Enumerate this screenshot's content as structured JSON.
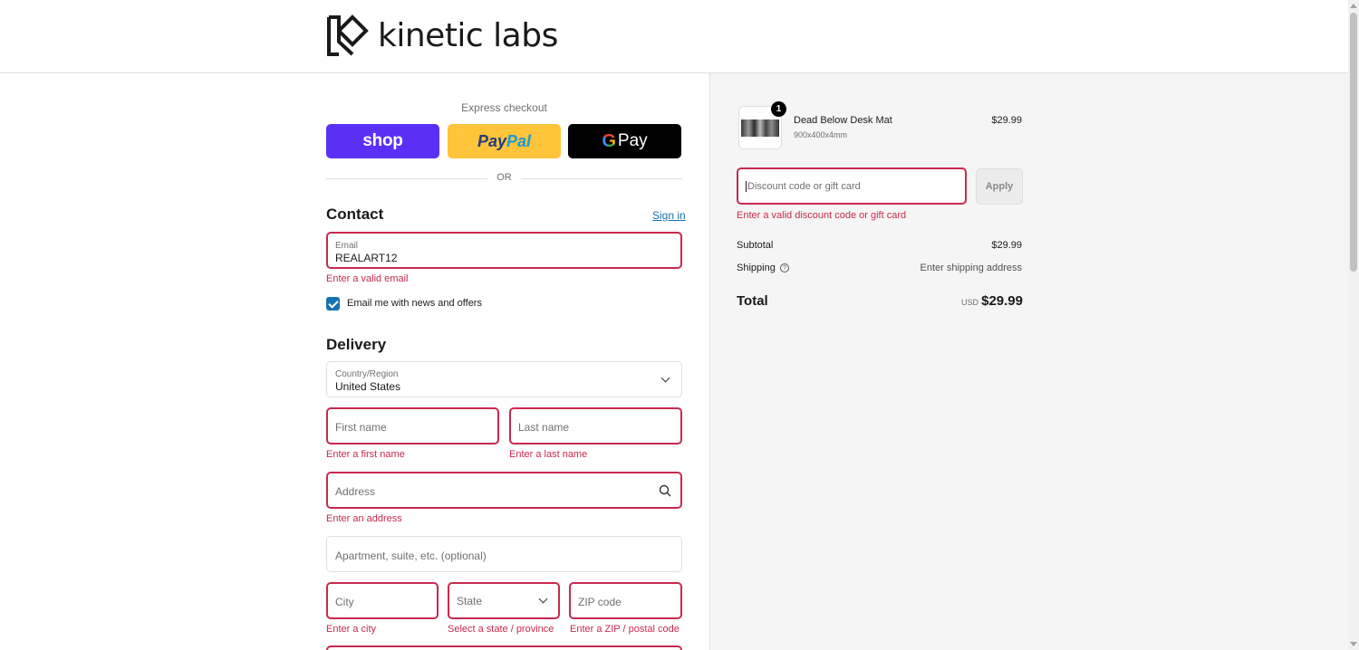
{
  "brand": {
    "name": "kinetic labs"
  },
  "express": {
    "title": "Express checkout",
    "shop_label": "shop",
    "paypal_label_1": "Pay",
    "paypal_label_2": "Pal",
    "gpay_g": "G",
    "gpay_label": "Pay",
    "or_label": "OR"
  },
  "contact": {
    "title": "Contact",
    "signin_label": "Sign in",
    "email_label": "Email",
    "email_value": "REALART12",
    "email_error": "Enter a valid email",
    "newsletter_label": "Email me with news and offers",
    "newsletter_checked": true
  },
  "delivery": {
    "title": "Delivery",
    "country_label": "Country/Region",
    "country_value": "United States",
    "first_name_placeholder": "First name",
    "first_name_error": "Enter a first name",
    "last_name_placeholder": "Last name",
    "last_name_error": "Enter a last name",
    "address_placeholder": "Address",
    "address_error": "Enter an address",
    "apartment_placeholder": "Apartment, suite, etc. (optional)",
    "city_placeholder": "City",
    "city_error": "Enter a city",
    "state_placeholder": "State",
    "state_error": "Select a state / province",
    "zip_placeholder": "ZIP code",
    "zip_error": "Enter a ZIP / postal code"
  },
  "summary": {
    "item": {
      "quantity": "1",
      "name": "Dead Below Desk Mat",
      "variant": "900x400x4mm",
      "price": "$29.99"
    },
    "discount_placeholder": "Discount code or gift card",
    "apply_label": "Apply",
    "discount_error": "Enter a valid discount code or gift card",
    "subtotal_label": "Subtotal",
    "subtotal_value": "$29.99",
    "shipping_label": "Shipping",
    "shipping_help": "?",
    "shipping_value": "Enter shipping address",
    "total_label": "Total",
    "total_currency": "USD",
    "total_value": "$29.99"
  },
  "colors": {
    "error": "#c8294e",
    "link": "#1773b0",
    "shop_pay": "#5a31f4",
    "paypal": "#ffc439",
    "gpay": "#000000"
  }
}
